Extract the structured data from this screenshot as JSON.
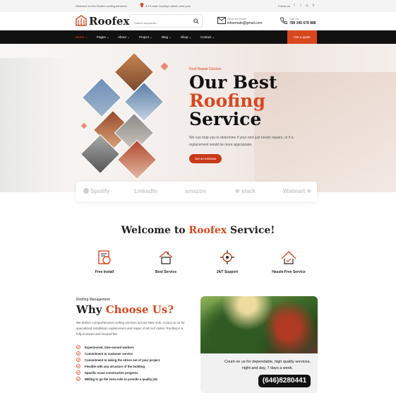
{
  "topbar": {
    "welcome": "Welcome to Our Roofex roofing services!",
    "address": "8-10 road, brooklyn street, new york",
    "follow": "Follow us",
    "socials": [
      "facebook-icon",
      "twitter-icon",
      "instagram-icon",
      "behance-icon"
    ]
  },
  "header": {
    "logo": "Roofex",
    "search_placeholder": "Search keywords...",
    "mail_label": "Send Us Email",
    "mail_value": "infoemalo@gmail.com",
    "call_label": "Call Us",
    "call_value": "789 345 678 888"
  },
  "nav": {
    "items": [
      "Home",
      "Pages",
      "About",
      "Project",
      "Blog",
      "Shop",
      "Contact"
    ],
    "active": "Home",
    "cta": "Get a quote"
  },
  "hero": {
    "kicker": "Roof Repair Division",
    "line1": "Our Best",
    "line2": "Roofing",
    "line3": "Service",
    "description": "We can help you to determine if your roof just needs repairs, or if a replacement would be more appropriate.",
    "button": "Get an estimate"
  },
  "brands": [
    "Spotify",
    "LinkedIn",
    "amazon",
    "slack",
    "Walmart"
  ],
  "welcome": {
    "prefix": "Welcome to ",
    "brand": "Roofex",
    "suffix": " Service!",
    "services": [
      "Free Install",
      "Best Service",
      "24/7 Support",
      "Hassle-Free Service"
    ]
  },
  "why": {
    "kicker": "Roofing Management",
    "title_prefix": "Why ",
    "title_accent": "Choose Us?",
    "description": "We deliver comprehensive roofing services across New York. Count on us for specialized installation replacement and repair of all roof styles. Roofing is a fully licensed and insured flat.",
    "checklist": [
      "Experienced, time-served workers",
      "Commitment to customer service",
      "Commitment to taking the stress out of your project.",
      "Flexible with any structure of the building",
      "Specific exact construction progress",
      "Willing to go the extra mile to provide a quality job"
    ]
  },
  "card": {
    "text": "Count on us for dependable, high quality services, night and day, 7 days a week.",
    "phone": "(646)8280441"
  },
  "colors": {
    "accent": "#d9471f",
    "dark": "#111111"
  }
}
